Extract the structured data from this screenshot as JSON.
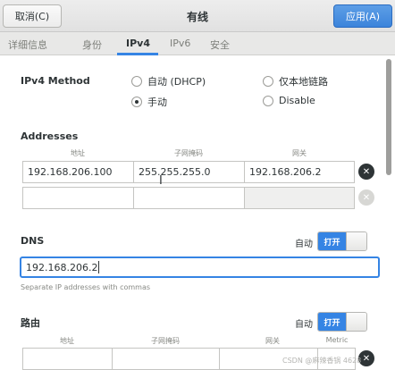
{
  "header": {
    "cancel_label": "取消(C)",
    "title": "有线",
    "apply_label": "应用(A)"
  },
  "tabs": [
    {
      "label": "详细信息",
      "active": false
    },
    {
      "label": "身份",
      "active": false
    },
    {
      "label": "IPv4",
      "active": true
    },
    {
      "label": "IPv6",
      "active": false
    },
    {
      "label": "安全",
      "active": false
    }
  ],
  "ipv4_method": {
    "label": "IPv4 Method",
    "options": [
      {
        "label": "自动 (DHCP)",
        "selected": false
      },
      {
        "label": "仅本地链路",
        "selected": false
      },
      {
        "label": "手动",
        "selected": true
      },
      {
        "label": "Disable",
        "selected": false
      }
    ]
  },
  "addresses": {
    "label": "Addresses",
    "columns": [
      "地址",
      "子网掩码",
      "网关"
    ],
    "rows": [
      {
        "address": "192.168.206.100",
        "netmask": "255.255.255.0",
        "gateway": "192.168.206.2"
      },
      {
        "address": "",
        "netmask": "",
        "gateway": ""
      }
    ]
  },
  "dns": {
    "label": "DNS",
    "auto_label": "自动",
    "toggle_label": "打开",
    "value": "192.168.206.2",
    "hint": "Separate IP addresses with commas"
  },
  "routes": {
    "label": "路由",
    "auto_label": "自动",
    "toggle_label": "打开",
    "columns": [
      "地址",
      "子网掩码",
      "网关",
      "Metric"
    ]
  },
  "icons": {
    "delete": "close-icon"
  },
  "colors": {
    "accent": "#3584e4",
    "apply_button": "#3c84db"
  },
  "watermark": "CSDN @麻辣香锅 4628"
}
